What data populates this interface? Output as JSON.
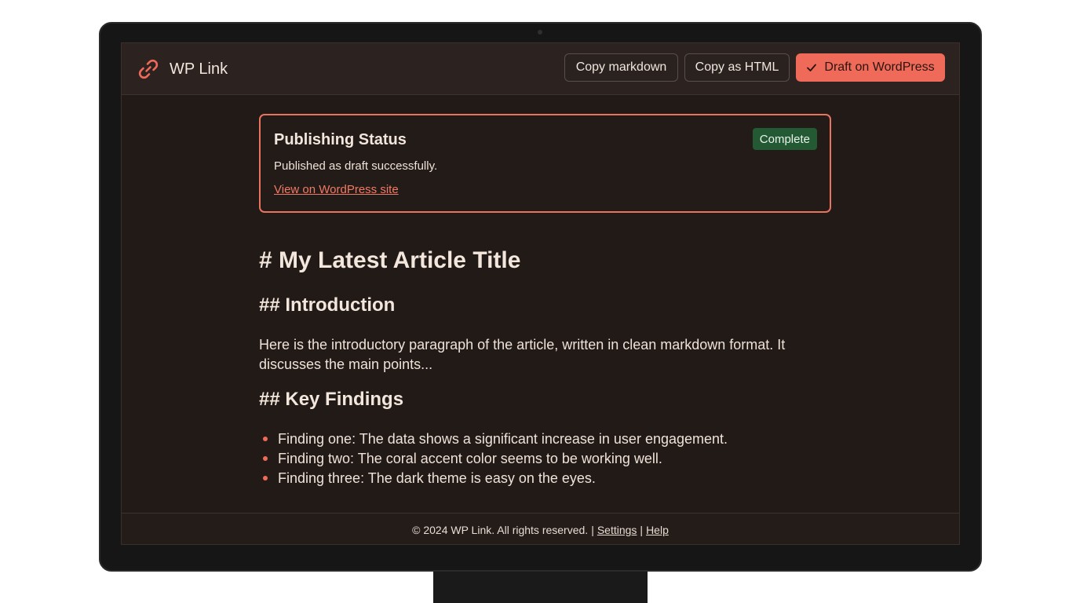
{
  "app": {
    "name": "WP Link",
    "accent_color": "#ef6a58",
    "icon": "link-icon"
  },
  "toolbar": {
    "copy_markdown_label": "Copy markdown",
    "copy_html_label": "Copy as HTML",
    "draft_label": "Draft on WordPress",
    "draft_icon": "check-icon"
  },
  "status": {
    "title": "Publishing Status",
    "badge": "Complete",
    "badge_color": "#235a34",
    "message": "Published as draft successfully.",
    "link_label": "View on WordPress site"
  },
  "article": {
    "h1": "# My Latest Article Title",
    "intro_heading": "## Introduction",
    "intro_paragraph": "Here is the introductory paragraph of the article, written in clean markdown format. It discusses the main points...",
    "findings_heading": "## Key Findings",
    "findings": [
      "Finding one: The data shows a significant increase in user engagement.",
      "Finding two: The coral accent color seems to be working well.",
      "Finding three: The dark theme is easy on the eyes."
    ]
  },
  "footer": {
    "copyright": "© 2024 WP Link. All rights reserved.",
    "separator": "|",
    "settings_label": "Settings",
    "help_label": "Help"
  }
}
